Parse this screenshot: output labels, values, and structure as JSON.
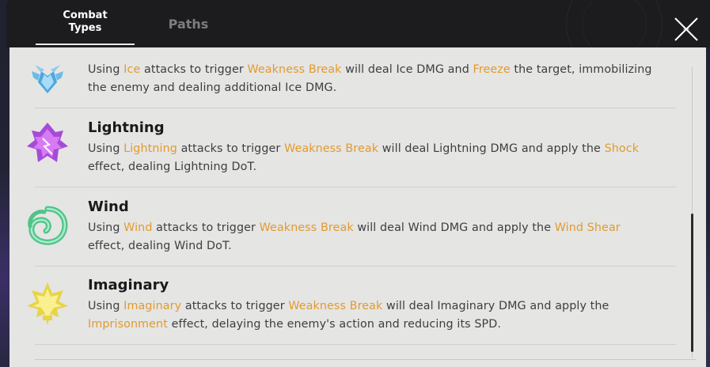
{
  "header": {
    "tabs": [
      {
        "label_line1": "Combat",
        "label_line2": "Types",
        "active": true
      },
      {
        "label": "Paths",
        "active": false
      }
    ],
    "close_icon": "close-icon"
  },
  "colors": {
    "highlight": "#e39a2d",
    "panel_bg": "#e5e5e4",
    "header_bg": "#1c1c1f"
  },
  "types": [
    {
      "name": "",
      "icon": "ice-icon",
      "desc": [
        {
          "t": "Using "
        },
        {
          "t": "Ice",
          "hl": true
        },
        {
          "t": " attacks to trigger "
        },
        {
          "t": "Weakness Break",
          "hl": true
        },
        {
          "t": " will deal Ice DMG and "
        },
        {
          "t": "Freeze",
          "hl": true
        },
        {
          "t": " the target, immobilizing the enemy and dealing additional Ice DMG."
        }
      ]
    },
    {
      "name": "Lightning",
      "icon": "lightning-icon",
      "desc": [
        {
          "t": "Using "
        },
        {
          "t": "Lightning",
          "hl": true
        },
        {
          "t": " attacks to trigger "
        },
        {
          "t": "Weakness Break",
          "hl": true
        },
        {
          "t": " will deal Lightning DMG and apply the "
        },
        {
          "t": "Shock",
          "hl": true
        },
        {
          "t": " effect, dealing Lightning DoT."
        }
      ]
    },
    {
      "name": "Wind",
      "icon": "wind-icon",
      "desc": [
        {
          "t": "Using "
        },
        {
          "t": "Wind",
          "hl": true
        },
        {
          "t": " attacks to trigger "
        },
        {
          "t": "Weakness Break",
          "hl": true
        },
        {
          "t": " will deal Wind DMG and apply the "
        },
        {
          "t": "Wind Shear",
          "hl": true
        },
        {
          "t": " effect, dealing Wind DoT."
        }
      ]
    },
    {
      "name": "Imaginary",
      "icon": "imaginary-icon",
      "desc": [
        {
          "t": "Using "
        },
        {
          "t": "Imaginary",
          "hl": true
        },
        {
          "t": " attacks to trigger "
        },
        {
          "t": "Weakness Break",
          "hl": true
        },
        {
          "t": " will deal Imaginary DMG and apply the "
        },
        {
          "t": "Imprisonment",
          "hl": true
        },
        {
          "t": " effect, delaying the enemy's action and reducing its SPD."
        }
      ]
    }
  ]
}
